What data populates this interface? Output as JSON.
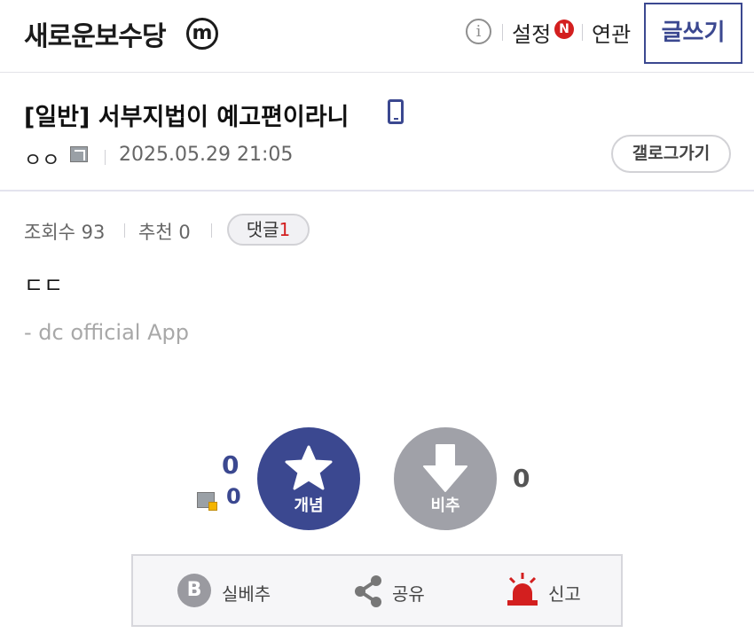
{
  "header": {
    "gallery_title": "새로운보수당",
    "minor_badge": "m",
    "info_icon": "i",
    "settings_label": "설정",
    "new_badge": "N",
    "related_label": "연관",
    "write_label": "글쓰기"
  },
  "post": {
    "title": "[일반] 서부지법이 예고편이라니",
    "author": "ㅇㅇ",
    "date": "2025.05.29 21:05",
    "gallog_label": "갤로그가기",
    "body": "ㄷㄷ",
    "app_signature": "- dc official App"
  },
  "stats": {
    "views": "조회수 93",
    "recommend": "추천 0",
    "comment_label": "댓글",
    "comment_count": "1"
  },
  "votes": {
    "up_count": "0",
    "fixed_up_count": "0",
    "up_label": "개념",
    "down_label": "비추",
    "down_count": "0"
  },
  "actions": {
    "best_icon": "B",
    "best_label": "실베추",
    "share_label": "공유",
    "report_label": "신고"
  },
  "colors": {
    "accent": "#3b4890",
    "down": "#a0a1a8",
    "alert": "#d31f1f"
  },
  "icons": [
    "minor-gallery-icon",
    "info-icon",
    "mobile-icon",
    "user-icon",
    "star-icon",
    "down-arrow-icon",
    "best-icon",
    "share-icon",
    "siren-icon"
  ]
}
